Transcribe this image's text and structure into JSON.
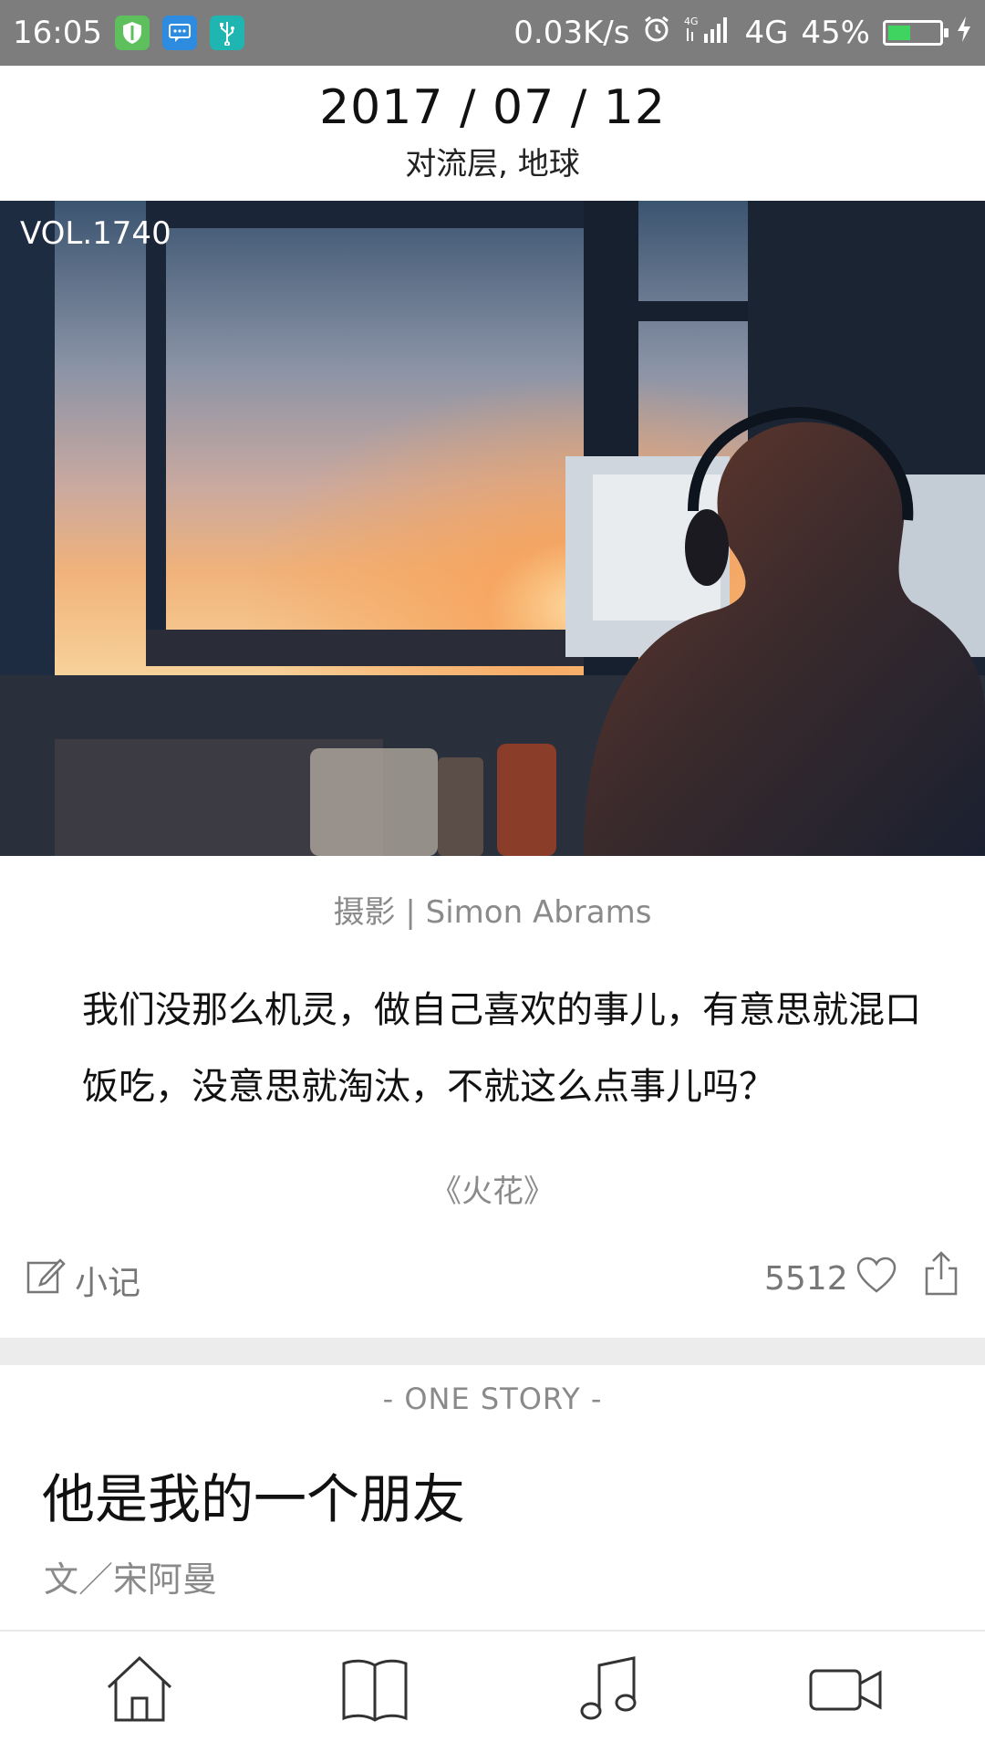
{
  "status_bar": {
    "time": "16:05",
    "network_speed": "0.03K/s",
    "network_type": "4G",
    "battery_percent": "45%",
    "battery_level": 0.45,
    "icons": [
      "shield-notification-icon",
      "message-notification-icon",
      "usb-notification-icon",
      "alarm-icon",
      "signal-icon",
      "battery-icon",
      "charging-icon"
    ]
  },
  "header": {
    "date": "2017 / 07 / 12",
    "location": "对流层, 地球"
  },
  "photo": {
    "volume": "VOL.1740",
    "credit": "摄影 | Simon Abrams"
  },
  "quote": {
    "text": "我们没那么机灵，做自己喜欢的事儿，有意思就混口饭吃，没意思就淘汰，不就这么点事儿吗？",
    "source": "《火花》"
  },
  "actions": {
    "note_label": "小记",
    "like_count": "5512"
  },
  "story": {
    "tag": "- ONE STORY -",
    "title": "他是我的一个朋友",
    "author": "文／宋阿曼"
  },
  "bottom_nav": {
    "items": [
      "home-icon",
      "book-icon",
      "music-icon",
      "video-icon"
    ]
  },
  "colors": {
    "status_bar_bg": "#7d7d7d",
    "muted_text": "#8a8a8a",
    "divider": "#ececec",
    "battery_green": "#3fd35f"
  }
}
